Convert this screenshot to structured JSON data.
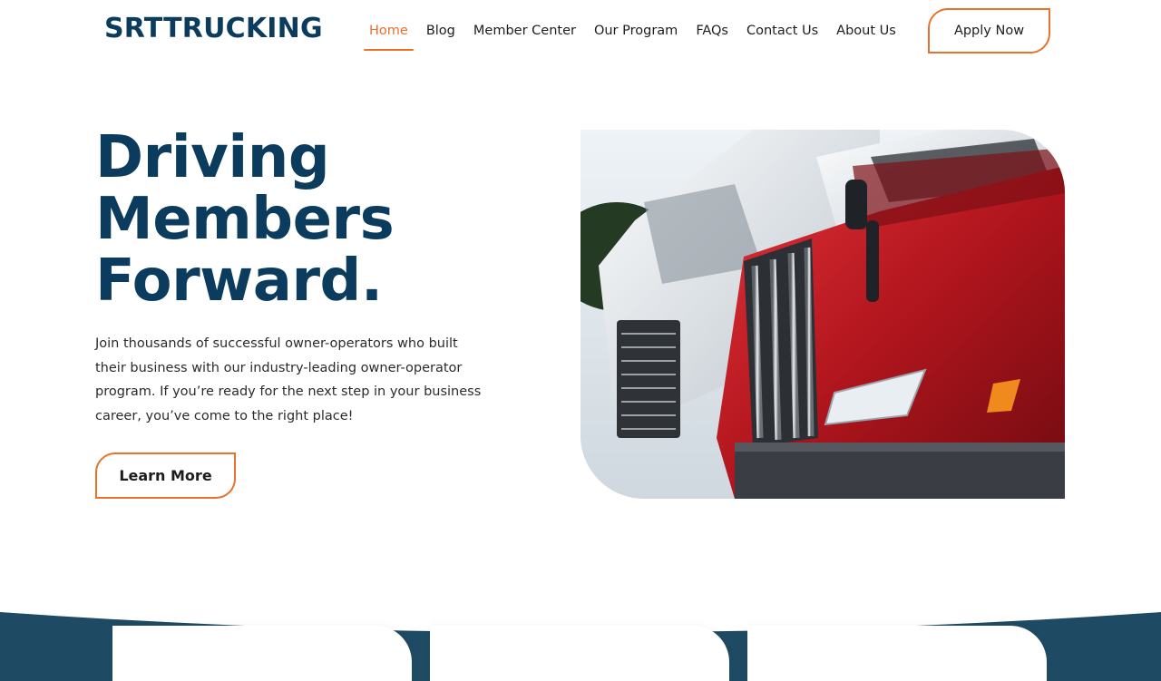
{
  "header": {
    "logo": "SRTTRUCKING",
    "nav": [
      {
        "label": "Home",
        "active": true
      },
      {
        "label": "Blog",
        "active": false
      },
      {
        "label": "Member Center",
        "active": false
      },
      {
        "label": "Our Program",
        "active": false
      },
      {
        "label": "FAQs",
        "active": false
      },
      {
        "label": "Contact Us",
        "active": false
      },
      {
        "label": "About Us",
        "active": false
      }
    ],
    "apply_label": "Apply Now"
  },
  "hero": {
    "title_lines": [
      "Driving",
      "Members",
      "Forward."
    ],
    "text": "Join thousands of successful owner-operators who built their business with our industry-leading owner-operator program. If you’re ready for the next step in your business career, you’ve come to the right place!",
    "learn_label": "Learn More"
  },
  "colors": {
    "brand_navy": "#0b3c5d",
    "accent_orange": "#e8712b"
  }
}
